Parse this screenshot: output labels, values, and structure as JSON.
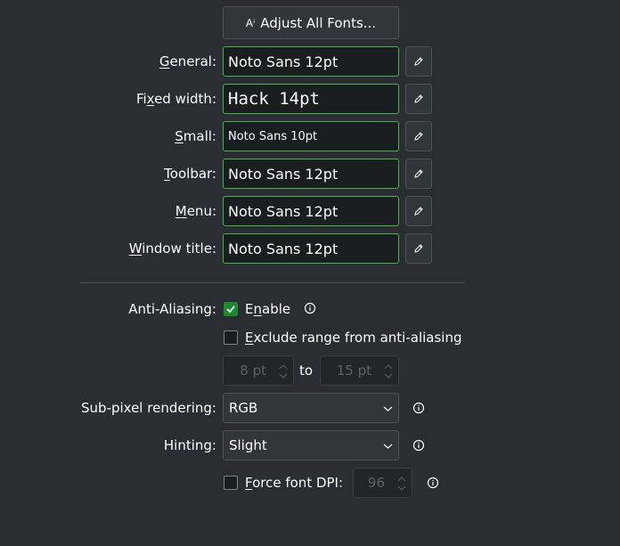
{
  "adjust_all_fonts": {
    "label": "Adjust All Fonts..."
  },
  "fonts": [
    {
      "label_u": "G",
      "label_rest": "eneral:",
      "label_pre": "",
      "value": "Noto Sans 12pt"
    },
    {
      "label_pre": "Fi",
      "label_u": "x",
      "label_rest": "ed width:",
      "value": "Hack 14pt"
    },
    {
      "label_pre": "",
      "label_u": "S",
      "label_rest": "mall:",
      "value": "Noto Sans 10pt"
    },
    {
      "label_pre": "",
      "label_u": "T",
      "label_rest": "oolbar:",
      "value": "Noto Sans 12pt"
    },
    {
      "label_pre": "",
      "label_u": "M",
      "label_rest": "enu:",
      "value": "Noto Sans 12pt"
    },
    {
      "label_pre": "",
      "label_u": "W",
      "label_rest": "indow title:",
      "value": "Noto Sans 12pt"
    }
  ],
  "anti_aliasing": {
    "label": "Anti-Aliasing:",
    "enable_pre": "E",
    "enable_u": "n",
    "enable_rest": "able",
    "enabled": true,
    "exclude_u": "E",
    "exclude_rest": "xclude range from anti-aliasing",
    "exclude_checked": false,
    "range_from": "8 pt",
    "range_to_label": "to",
    "range_to": "15 pt"
  },
  "subpixel": {
    "label": "Sub-pixel rendering:",
    "value": "RGB"
  },
  "hinting": {
    "label": "Hinting:",
    "value": "Slight"
  },
  "force_dpi": {
    "label_u": "F",
    "label_rest": "orce font DPI:",
    "checked": false,
    "value": "96"
  },
  "colors": {
    "accent_border": "#44b54b",
    "check_fill": "#1b8a2e",
    "background": "#2a2e32"
  },
  "icons": {
    "edit": "pencil-icon",
    "info": "info-icon",
    "font": "font-size-icon"
  }
}
